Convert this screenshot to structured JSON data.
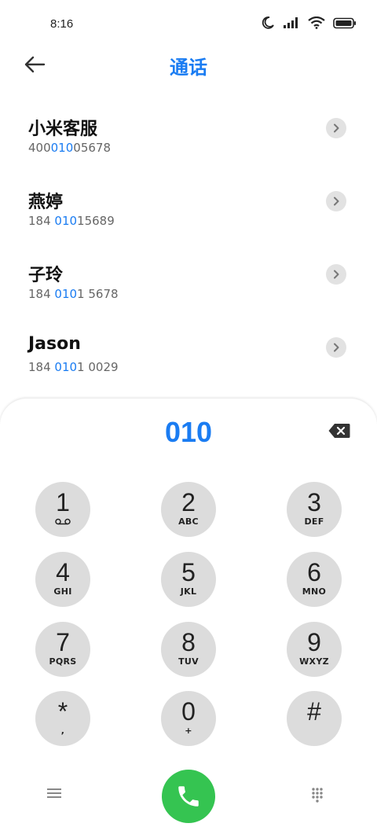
{
  "status": {
    "time": "8:16"
  },
  "header": {
    "title": "通话"
  },
  "contacts": [
    {
      "name": "小米客服",
      "number_parts": [
        "400",
        "010",
        "05678"
      ]
    },
    {
      "name": "燕婷",
      "number_parts": [
        "184 ",
        "010",
        "15689"
      ]
    },
    {
      "name": "子玲",
      "number_parts": [
        "184 ",
        "010",
        "1 5678"
      ]
    },
    {
      "name": "Jason",
      "number_parts": [
        "184 ",
        "010",
        "1 0029"
      ]
    }
  ],
  "dialpad": {
    "entered": "010",
    "keys": [
      {
        "digit": "1",
        "letters": ""
      },
      {
        "digit": "2",
        "letters": "ABC"
      },
      {
        "digit": "3",
        "letters": "DEF"
      },
      {
        "digit": "4",
        "letters": "GHI"
      },
      {
        "digit": "5",
        "letters": "JKL"
      },
      {
        "digit": "6",
        "letters": "MNO"
      },
      {
        "digit": "7",
        "letters": "PQRS"
      },
      {
        "digit": "8",
        "letters": "TUV"
      },
      {
        "digit": "9",
        "letters": "WXYZ"
      },
      {
        "digit": "*",
        "letters": ","
      },
      {
        "digit": "0",
        "letters": "+"
      },
      {
        "digit": "#",
        "letters": ""
      }
    ]
  },
  "colors": {
    "accent": "#1a7cf2",
    "call": "#35c451",
    "key_bg": "#dcdcdc"
  }
}
